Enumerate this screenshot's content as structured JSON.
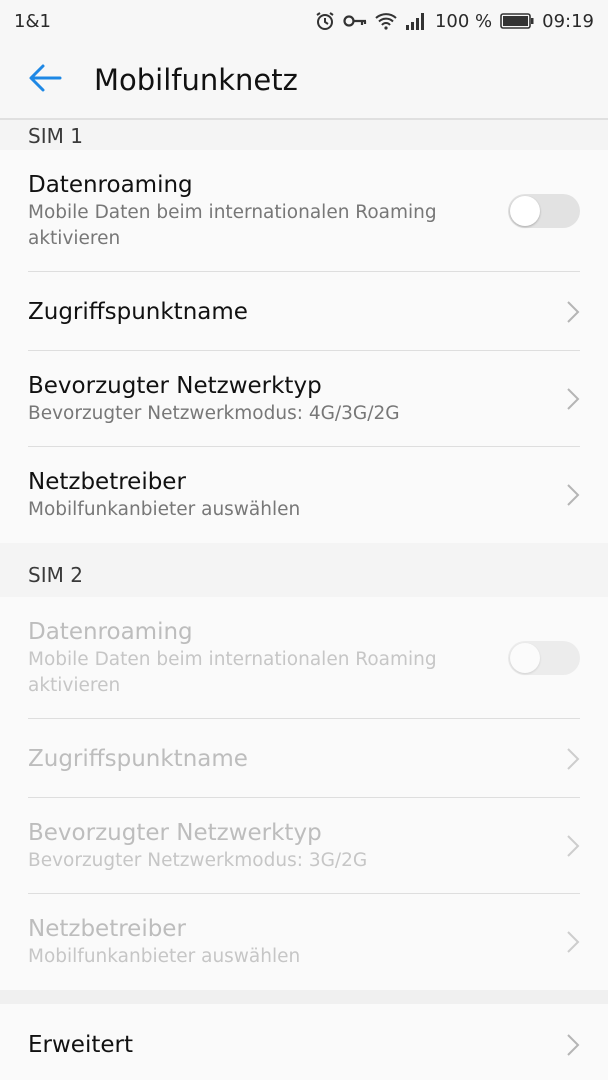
{
  "status_bar": {
    "carrier": "1&1",
    "battery_percent": "100 %",
    "time": "09:19",
    "icons": [
      "alarm-icon",
      "key-icon",
      "wifi-icon",
      "signal-icon",
      "battery-icon"
    ]
  },
  "app_bar": {
    "title": "Mobilfunknetz",
    "back_icon": "arrow-left-icon",
    "accent_color": "#1e88e5"
  },
  "sim1": {
    "header": "SIM 1",
    "data_roaming": {
      "title": "Datenroaming",
      "subtitle": "Mobile Daten beim internationalen Roaming aktivieren",
      "enabled": false
    },
    "apn": {
      "title": "Zugriffspunktname"
    },
    "network_type": {
      "title": "Bevorzugter Netzwerktyp",
      "subtitle": "Bevorzugter Netzwerkmodus: 4G/3G/2G"
    },
    "operator": {
      "title": "Netzbetreiber",
      "subtitle": "Mobilfunkanbieter auswählen"
    }
  },
  "sim2": {
    "header": "SIM 2",
    "data_roaming": {
      "title": "Datenroaming",
      "subtitle": "Mobile Daten beim internationalen Roaming aktivieren",
      "enabled": false
    },
    "apn": {
      "title": "Zugriffspunktname"
    },
    "network_type": {
      "title": "Bevorzugter Netzwerktyp",
      "subtitle": "Bevorzugter Netzwerkmodus: 3G/2G"
    },
    "operator": {
      "title": "Netzbetreiber",
      "subtitle": "Mobilfunkanbieter auswählen"
    }
  },
  "advanced": {
    "title": "Erweitert"
  }
}
